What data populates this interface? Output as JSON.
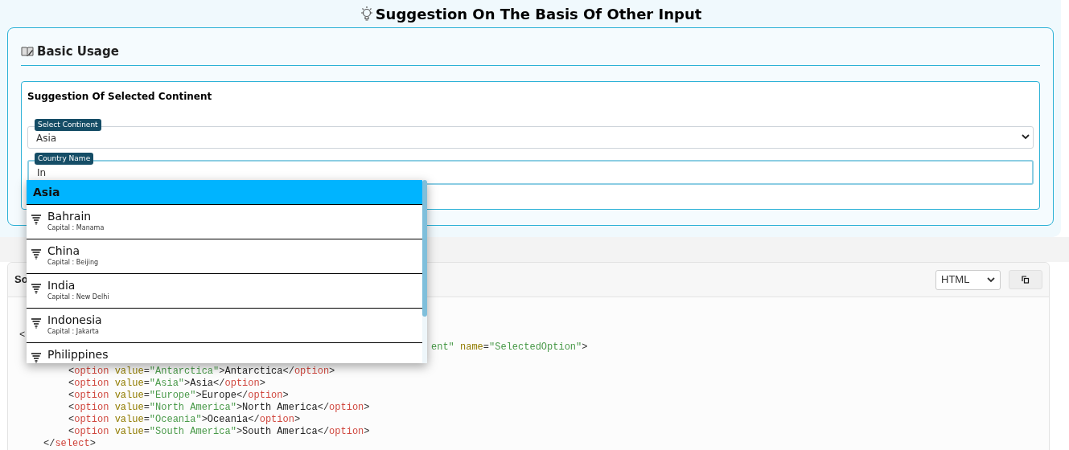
{
  "page_title": "Suggestion On The Basis Of Other Input",
  "section": {
    "title": "Basic Usage"
  },
  "demo": {
    "title": "Suggestion Of Selected Continent",
    "continent_select": {
      "label": "Select Continent",
      "value": "Asia"
    },
    "country_field": {
      "label": "Country Name",
      "value": "In"
    },
    "suggestions": {
      "group": "Asia",
      "items": [
        {
          "name": "Bahrain",
          "capital": "Capital : Manama"
        },
        {
          "name": "China",
          "capital": "Capital : Beijing"
        },
        {
          "name": "India",
          "capital": "Capital : New Delhi"
        },
        {
          "name": "Indonesia",
          "capital": "Capital : Jakarta"
        },
        {
          "name": "Philippines"
        }
      ]
    }
  },
  "source": {
    "title": "So",
    "language": "HTML",
    "code_lines": [
      [
        {
          "kind": "punct",
          "text": "<"
        }
      ],
      [
        {
          "kind": "value",
          "text": "ent\""
        },
        {
          "kind": "attr",
          "text": "name"
        },
        {
          "kind": "punct",
          "text": "="
        },
        {
          "kind": "value",
          "text": "\"SelectedOption\""
        },
        {
          "kind": "punct",
          "text": ">"
        }
      ],
      [
        {
          "kind": "punct",
          "text": "<"
        },
        {
          "kind": "tag",
          "text": "option"
        },
        {
          "kind": "attr",
          "text": "value"
        },
        {
          "kind": "punct",
          "text": "="
        },
        {
          "kind": "value",
          "text": "\"Antarctica\""
        },
        {
          "kind": "punct",
          "text": ">"
        },
        {
          "kind": "text",
          "text": "Antarctica"
        },
        {
          "kind": "punct",
          "text": "</"
        },
        {
          "kind": "tag",
          "text": "option"
        },
        {
          "kind": "punct",
          "text": ">"
        }
      ],
      [
        {
          "kind": "punct",
          "text": "<"
        },
        {
          "kind": "tag",
          "text": "option"
        },
        {
          "kind": "attr",
          "text": "value"
        },
        {
          "kind": "punct",
          "text": "="
        },
        {
          "kind": "value",
          "text": "\"Asia\""
        },
        {
          "kind": "punct",
          "text": ">"
        },
        {
          "kind": "text",
          "text": "Asia"
        },
        {
          "kind": "punct",
          "text": "</"
        },
        {
          "kind": "tag",
          "text": "option"
        },
        {
          "kind": "punct",
          "text": ">"
        }
      ],
      [
        {
          "kind": "punct",
          "text": "<"
        },
        {
          "kind": "tag",
          "text": "option"
        },
        {
          "kind": "attr",
          "text": "value"
        },
        {
          "kind": "punct",
          "text": "="
        },
        {
          "kind": "value",
          "text": "\"Europe\""
        },
        {
          "kind": "punct",
          "text": ">"
        },
        {
          "kind": "text",
          "text": "Europe"
        },
        {
          "kind": "punct",
          "text": "</"
        },
        {
          "kind": "tag",
          "text": "option"
        },
        {
          "kind": "punct",
          "text": ">"
        }
      ],
      [
        {
          "kind": "punct",
          "text": "<"
        },
        {
          "kind": "tag",
          "text": "option"
        },
        {
          "kind": "attr",
          "text": "value"
        },
        {
          "kind": "punct",
          "text": "="
        },
        {
          "kind": "value",
          "text": "\"North America\""
        },
        {
          "kind": "punct",
          "text": ">"
        },
        {
          "kind": "text",
          "text": "North America"
        },
        {
          "kind": "punct",
          "text": "</"
        },
        {
          "kind": "tag",
          "text": "option"
        },
        {
          "kind": "punct",
          "text": ">"
        }
      ],
      [
        {
          "kind": "punct",
          "text": "<"
        },
        {
          "kind": "tag",
          "text": "option"
        },
        {
          "kind": "attr",
          "text": "value"
        },
        {
          "kind": "punct",
          "text": "="
        },
        {
          "kind": "value",
          "text": "\"Oceania\""
        },
        {
          "kind": "punct",
          "text": ">"
        },
        {
          "kind": "text",
          "text": "Oceania"
        },
        {
          "kind": "punct",
          "text": "</"
        },
        {
          "kind": "tag",
          "text": "option"
        },
        {
          "kind": "punct",
          "text": ">"
        }
      ],
      [
        {
          "kind": "punct",
          "text": "<"
        },
        {
          "kind": "tag",
          "text": "option"
        },
        {
          "kind": "attr",
          "text": "value"
        },
        {
          "kind": "punct",
          "text": "="
        },
        {
          "kind": "value",
          "text": "\"South America\""
        },
        {
          "kind": "punct",
          "text": ">"
        },
        {
          "kind": "text",
          "text": "South America"
        },
        {
          "kind": "punct",
          "text": "</"
        },
        {
          "kind": "tag",
          "text": "option"
        },
        {
          "kind": "punct",
          "text": ">"
        }
      ],
      [
        {
          "kind": "punct",
          "text": "</"
        },
        {
          "kind": "tag",
          "text": "select"
        },
        {
          "kind": "punct",
          "text": ">"
        }
      ]
    ]
  }
}
